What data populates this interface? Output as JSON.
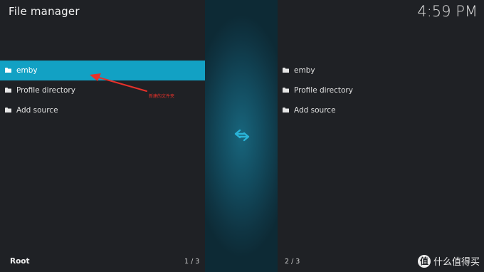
{
  "header": {
    "title": "File manager",
    "clock": "4:59 PM"
  },
  "left_panel": {
    "items": [
      {
        "label": "emby",
        "icon": "folder-icon",
        "selected": true
      },
      {
        "label": "Profile directory",
        "icon": "folder-icon",
        "selected": false
      },
      {
        "label": "Add source",
        "icon": "folder-icon",
        "selected": false
      }
    ],
    "footer_label": "Root",
    "page_indicator": "1 / 3"
  },
  "right_panel": {
    "items": [
      {
        "label": "emby",
        "icon": "folder-icon"
      },
      {
        "label": "Profile directory",
        "icon": "folder-icon"
      },
      {
        "label": "Add source",
        "icon": "folder-icon"
      }
    ],
    "page_indicator": "2 / 3"
  },
  "center": {
    "icon": "swap-arrows-icon"
  },
  "annotation": {
    "text": "新建的文件夹",
    "color": "#e8312a"
  },
  "watermark": {
    "badge": "值",
    "text": "什么值得买"
  },
  "colors": {
    "accent": "#12a1c4",
    "background": "#1f2125",
    "center_strip": "#124a5d"
  }
}
